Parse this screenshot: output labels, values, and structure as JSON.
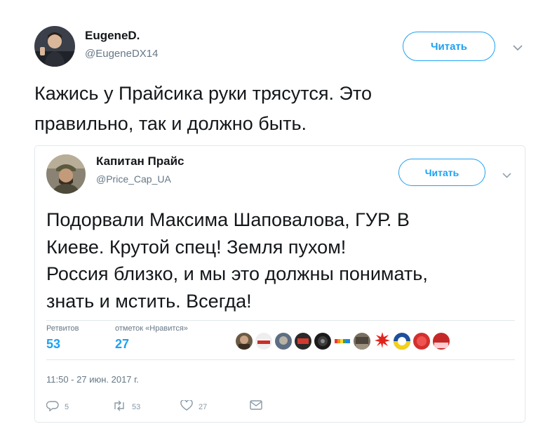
{
  "outer": {
    "display_name": "EugeneD.",
    "handle": "@EugeneDX14",
    "follow_label": "Читать",
    "text_line1": "Кажись у Прайсика руки трясутся. Это",
    "text_line2": "правильно, так и должно быть."
  },
  "quoted": {
    "display_name": "Капитан Прайс",
    "handle": "@Price_Cap_UA",
    "follow_label": "Читать",
    "text_lines": [
      "Подорвали Максима Шаповалова, ГУР. В",
      "Киеве. Крутой спец! Земля пухом!",
      "Россия близко, и мы это должны понимать,",
      "знать и мстить. Всегда!"
    ],
    "stats": {
      "retweets_label": "Ретвитов",
      "retweets_value": "53",
      "likes_label": "отметок «Нравится»",
      "likes_value": "27"
    },
    "timestamp": "11:50 - 27 июн. 2017 г.",
    "actions": {
      "reply_count": "5",
      "retweet_count": "53",
      "like_count": "27"
    }
  },
  "colors": {
    "accent": "#1da1f2",
    "muted": "#657786",
    "border": "#e1e8ed"
  },
  "icons": [
    "chevron-down-icon",
    "reply-icon",
    "retweet-icon",
    "heart-icon",
    "message-icon"
  ]
}
